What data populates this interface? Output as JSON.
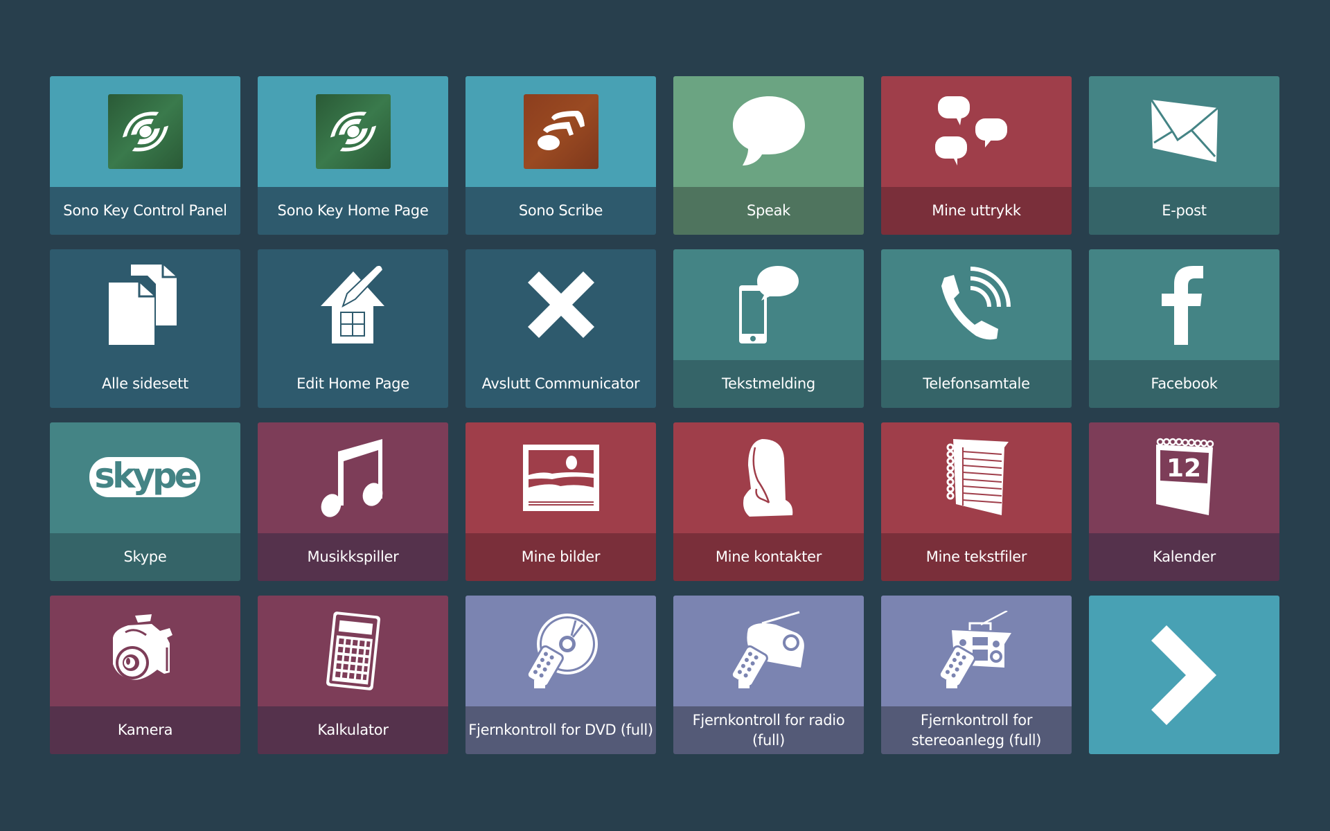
{
  "colors": {
    "background": "#283f4d",
    "cyan": "#48a1b4",
    "navy": "#2e5a6d",
    "green": "#6ba482",
    "red": "#9f3e4a",
    "teal": "#448485",
    "plum": "#7d3d58",
    "lavender": "#7b84b1"
  },
  "tiles": [
    {
      "label": "Sono Key Control Panel",
      "icon": "sono-key-icon",
      "color": "cyan"
    },
    {
      "label": "Sono Key Home Page",
      "icon": "sono-key-icon",
      "color": "cyan"
    },
    {
      "label": "Sono Scribe",
      "icon": "sono-scribe-icon",
      "color": "cyan"
    },
    {
      "label": "Speak",
      "icon": "speech-bubble-icon",
      "color": "green"
    },
    {
      "label": "Mine uttrykk",
      "icon": "speech-bubbles-icon",
      "color": "red"
    },
    {
      "label": "E-post",
      "icon": "envelope-icon",
      "color": "teal"
    },
    {
      "label": "Alle sidesett",
      "icon": "documents-icon",
      "color": "navy"
    },
    {
      "label": "Edit Home Page",
      "icon": "house-pencil-icon",
      "color": "navy"
    },
    {
      "label": "Avslutt Communicator",
      "icon": "close-icon",
      "color": "navy"
    },
    {
      "label": "Tekstmelding",
      "icon": "phone-message-icon",
      "color": "teal"
    },
    {
      "label": "Telefonsamtale",
      "icon": "phone-call-icon",
      "color": "teal"
    },
    {
      "label": "Facebook",
      "icon": "facebook-icon",
      "color": "teal"
    },
    {
      "label": "Skype",
      "icon": "skype-icon",
      "color": "teal"
    },
    {
      "label": "Musikkspiller",
      "icon": "music-note-icon",
      "color": "plum"
    },
    {
      "label": "Mine bilder",
      "icon": "picture-icon",
      "color": "red"
    },
    {
      "label": "Mine kontakter",
      "icon": "contact-person-icon",
      "color": "red"
    },
    {
      "label": "Mine tekstfiler",
      "icon": "notebook-icon",
      "color": "red"
    },
    {
      "label": "Kalender",
      "icon": "calendar-icon",
      "color": "plum"
    },
    {
      "label": "Kamera",
      "icon": "camera-icon",
      "color": "plum"
    },
    {
      "label": "Kalkulator",
      "icon": "calculator-icon",
      "color": "plum"
    },
    {
      "label": "Fjernkontroll for DVD (full)",
      "icon": "remote-dvd-icon",
      "color": "lavender"
    },
    {
      "label": "Fjernkontroll for radio (full)",
      "icon": "remote-radio-icon",
      "color": "lavender"
    },
    {
      "label": "Fjernkontroll for stereoanlegg (full)",
      "icon": "remote-stereo-icon",
      "color": "lavender"
    }
  ],
  "next_button": {
    "icon": "chevron-right-icon"
  },
  "calendar_day": "12",
  "skype_text": "skype"
}
